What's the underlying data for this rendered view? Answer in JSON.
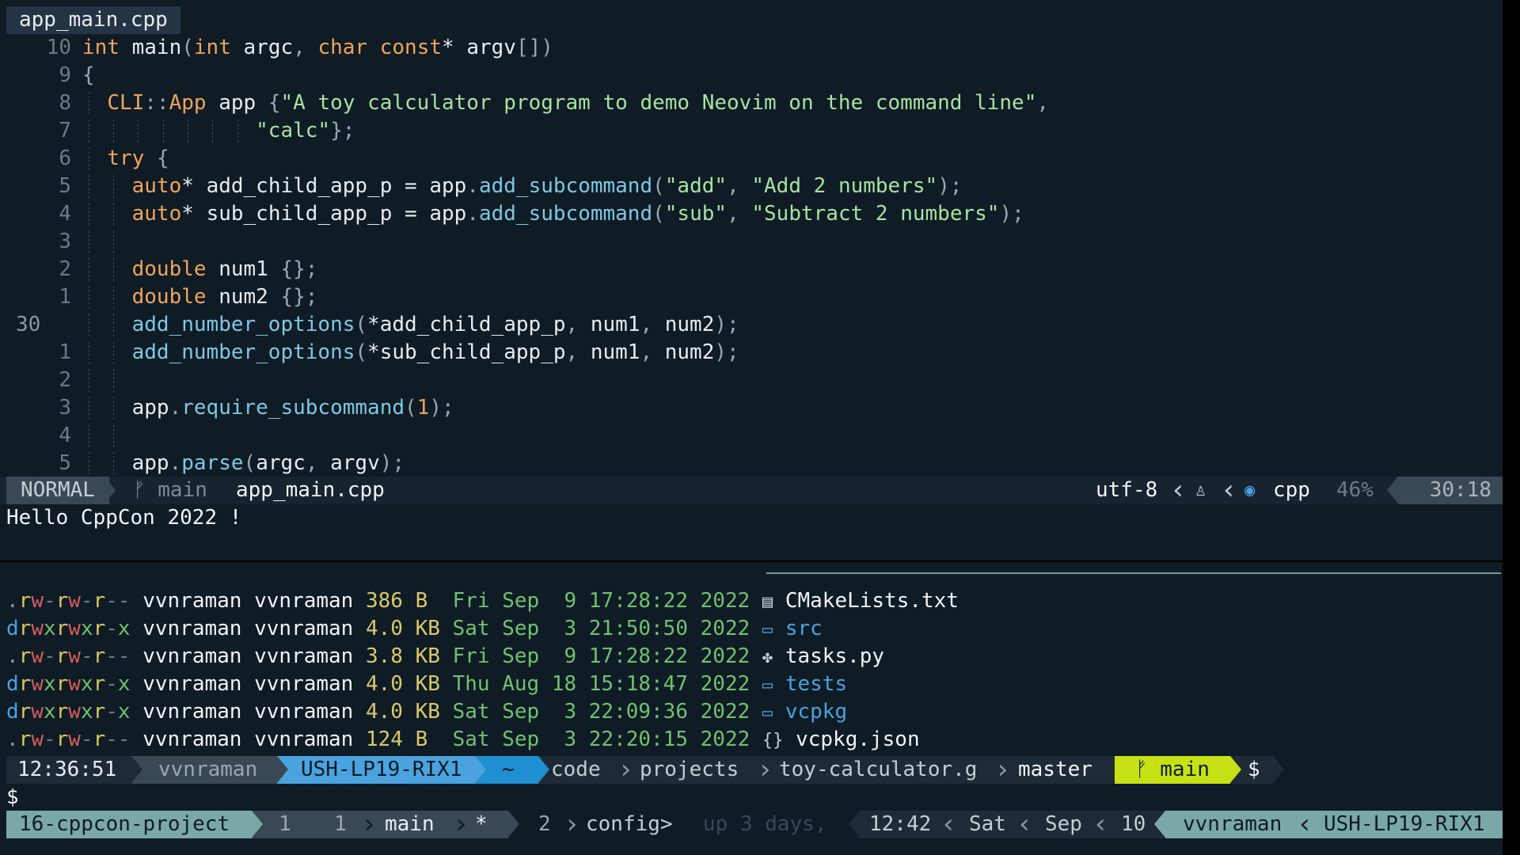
{
  "editor": {
    "tab_label": "app_main.cpp",
    "lines": [
      {
        "n": "10",
        "html": "<span class=\"kw\">int</span> <span class=\"var\">main</span><span class=\"pun\">(</span><span class=\"kw\">int</span> <span class=\"var\">argc</span><span class=\"pun\">,</span> <span class=\"kw\">char const</span><span class=\"var\">*</span> <span class=\"var\">argv</span><span class=\"pun\">[])</span>"
      },
      {
        "n": "9",
        "html": "<span class=\"pun\">{</span>"
      },
      {
        "n": "8",
        "html": "  <span class=\"kw\">CLI</span><span class=\"pun\">::</span><span class=\"kw\">App</span> <span class=\"var\">app</span> <span class=\"pun\">{</span><span class=\"str\">\"A toy calculator program to demo Neovim on the command line\"</span><span class=\"pun\">,</span>"
      },
      {
        "n": "7",
        "html": "              <span class=\"str\">\"calc\"</span><span class=\"pun\">};</span>"
      },
      {
        "n": "6",
        "html": "  <span class=\"kw\">try</span> <span class=\"pun\">{</span>"
      },
      {
        "n": "5",
        "html": "    <span class=\"kw\">auto</span><span class=\"var\">*</span> <span class=\"var\">add_child_app_p</span> <span class=\"var\">=</span> <span class=\"var\">app</span><span class=\"pun\">.</span><span class=\"fn\">add_subcommand</span><span class=\"pun\">(</span><span class=\"str\">\"add\"</span><span class=\"pun\">,</span> <span class=\"str\">\"Add 2 numbers\"</span><span class=\"pun\">);</span>"
      },
      {
        "n": "4",
        "html": "    <span class=\"kw\">auto</span><span class=\"var\">*</span> <span class=\"var\">sub_child_app_p</span> <span class=\"var\">=</span> <span class=\"var\">app</span><span class=\"pun\">.</span><span class=\"fn\">add_subcommand</span><span class=\"pun\">(</span><span class=\"str\">\"sub\"</span><span class=\"pun\">,</span> <span class=\"str\">\"Subtract 2 numbers\"</span><span class=\"pun\">);</span>"
      },
      {
        "n": "3",
        "html": ""
      },
      {
        "n": "2",
        "html": "    <span class=\"kw\">double</span> <span class=\"var\">num1</span> <span class=\"pun\">{};</span>"
      },
      {
        "n": "1",
        "html": "    <span class=\"kw\">double</span> <span class=\"var\">num2</span> <span class=\"pun\">{};</span>"
      },
      {
        "n": "30",
        "current": true,
        "html": "    <span class=\"fn\">add_number_options</span><span class=\"pun\">(</span><span class=\"var\">*add_child_app_p</span><span class=\"pun\">,</span> <span class=\"var\">num1</span><span class=\"pun\">,</span> <span class=\"var\">num2</span><span class=\"pun\">);</span>"
      },
      {
        "n": "1",
        "html": "    <span class=\"fn\">add_number_options</span><span class=\"pun\">(</span><span class=\"var\">*sub_child_app_p</span><span class=\"pun\">,</span> <span class=\"var\">num1</span><span class=\"pun\">,</span> <span class=\"var\">num2</span><span class=\"pun\">);</span>"
      },
      {
        "n": "2",
        "html": ""
      },
      {
        "n": "3",
        "html": "    <span class=\"var\">app</span><span class=\"pun\">.</span><span class=\"fn\">require_subcommand</span><span class=\"pun\">(</span><span class=\"num\">1</span><span class=\"pun\">);</span>"
      },
      {
        "n": "4",
        "html": ""
      },
      {
        "n": "5",
        "html": "    <span class=\"var\">app</span><span class=\"pun\">.</span><span class=\"fn\">parse</span><span class=\"pun\">(</span><span class=\"var\">argc</span><span class=\"pun\">,</span> <span class=\"var\">argv</span><span class=\"pun\">);</span>"
      }
    ]
  },
  "statusline": {
    "mode": "NORMAL",
    "branch_icon": "ᚠ",
    "branch": "main",
    "file": "app_main.cpp",
    "encoding": "utf-8",
    "os_icon": "♙",
    "filetype_icon": "◉",
    "filetype": "cpp",
    "percent": "46%",
    "position": "30:18"
  },
  "command_output": "Hello CppCon 2022 !",
  "listing": [
    {
      "perm": [
        [
          "p-dot",
          "."
        ],
        [
          "p-r",
          "r"
        ],
        [
          "p-w",
          "w"
        ],
        [
          "p-dash",
          "-"
        ],
        [
          "p-r",
          "r"
        ],
        [
          "p-w",
          "w"
        ],
        [
          "p-dash",
          "-"
        ],
        [
          "p-r",
          "r"
        ],
        [
          "p-dash",
          "-"
        ],
        [
          "p-dash",
          "-"
        ]
      ],
      "user": "vvnraman",
      "group": "vvnraman",
      "size": "386 B ",
      "day": "Fri",
      "mon": "Sep",
      "dd": " 9",
      "time": "17:28:22",
      "year": "2022",
      "icon": "▤",
      "name": "CMakeLists.txt",
      "dir": false
    },
    {
      "perm": [
        [
          "p-d",
          "d"
        ],
        [
          "p-r",
          "r"
        ],
        [
          "p-w",
          "w"
        ],
        [
          "p-x",
          "x"
        ],
        [
          "p-r",
          "r"
        ],
        [
          "p-w",
          "w"
        ],
        [
          "p-x",
          "x"
        ],
        [
          "p-r",
          "r"
        ],
        [
          "p-dash",
          "-"
        ],
        [
          "p-x",
          "x"
        ]
      ],
      "user": "vvnraman",
      "group": "vvnraman",
      "size": "4.0 KB",
      "day": "Sat",
      "mon": "Sep",
      "dd": " 3",
      "time": "21:50:50",
      "year": "2022",
      "icon": "▭",
      "name": "src",
      "dir": true
    },
    {
      "perm": [
        [
          "p-dot",
          "."
        ],
        [
          "p-r",
          "r"
        ],
        [
          "p-w",
          "w"
        ],
        [
          "p-dash",
          "-"
        ],
        [
          "p-r",
          "r"
        ],
        [
          "p-w",
          "w"
        ],
        [
          "p-dash",
          "-"
        ],
        [
          "p-r",
          "r"
        ],
        [
          "p-dash",
          "-"
        ],
        [
          "p-dash",
          "-"
        ]
      ],
      "user": "vvnraman",
      "group": "vvnraman",
      "size": "3.8 KB",
      "day": "Fri",
      "mon": "Sep",
      "dd": " 9",
      "time": "17:28:22",
      "year": "2022",
      "icon": "✤",
      "name": "tasks.py",
      "dir": false
    },
    {
      "perm": [
        [
          "p-d",
          "d"
        ],
        [
          "p-r",
          "r"
        ],
        [
          "p-w",
          "w"
        ],
        [
          "p-x",
          "x"
        ],
        [
          "p-r",
          "r"
        ],
        [
          "p-w",
          "w"
        ],
        [
          "p-x",
          "x"
        ],
        [
          "p-r",
          "r"
        ],
        [
          "p-dash",
          "-"
        ],
        [
          "p-x",
          "x"
        ]
      ],
      "user": "vvnraman",
      "group": "vvnraman",
      "size": "4.0 KB",
      "day": "Thu",
      "mon": "Aug",
      "dd": "18",
      "time": "15:18:47",
      "year": "2022",
      "icon": "▭",
      "name": "tests",
      "dir": true
    },
    {
      "perm": [
        [
          "p-d",
          "d"
        ],
        [
          "p-r",
          "r"
        ],
        [
          "p-w",
          "w"
        ],
        [
          "p-x",
          "x"
        ],
        [
          "p-r",
          "r"
        ],
        [
          "p-w",
          "w"
        ],
        [
          "p-x",
          "x"
        ],
        [
          "p-r",
          "r"
        ],
        [
          "p-dash",
          "-"
        ],
        [
          "p-x",
          "x"
        ]
      ],
      "user": "vvnraman",
      "group": "vvnraman",
      "size": "4.0 KB",
      "day": "Sat",
      "mon": "Sep",
      "dd": " 3",
      "time": "22:09:36",
      "year": "2022",
      "icon": "▭",
      "name": "vcpkg",
      "dir": true
    },
    {
      "perm": [
        [
          "p-dot",
          "."
        ],
        [
          "p-r",
          "r"
        ],
        [
          "p-w",
          "w"
        ],
        [
          "p-dash",
          "-"
        ],
        [
          "p-r",
          "r"
        ],
        [
          "p-w",
          "w"
        ],
        [
          "p-dash",
          "-"
        ],
        [
          "p-r",
          "r"
        ],
        [
          "p-dash",
          "-"
        ],
        [
          "p-dash",
          "-"
        ]
      ],
      "user": "vvnraman",
      "group": "vvnraman",
      "size": "124 B ",
      "day": "Sat",
      "mon": "Sep",
      "dd": " 3",
      "time": "22:20:15",
      "year": "2022",
      "icon": "{}",
      "name": "vcpkg.json",
      "dir": false
    }
  ],
  "prompt": {
    "time": "12:36:51",
    "user": "vvnraman",
    "host": "USH-LP19-RIX1",
    "home": "~",
    "path": [
      "code",
      "projects",
      "toy-calculator.g",
      "master"
    ],
    "git_icon": "ᚠ",
    "git_branch": "main",
    "symbol": "$",
    "input_line": "$"
  },
  "tmux": {
    "session": "16-cppcon-project",
    "window_index": "1",
    "pane_index": "1",
    "window_name": "main",
    "window_flag": "*",
    "window2_index": "2",
    "window2_name": "config>",
    "uptime": "up 3 days,",
    "clock": "12:42",
    "day": "Sat",
    "month": "Sep",
    "date": "10",
    "user": "vvnraman",
    "host": "USH-LP19-RIX1"
  },
  "colors": {
    "background": "#0f1b25",
    "prompt_time_bg": "#1e2a35",
    "prompt_user_bg": "#3a4856",
    "prompt_host_bg": "#4aa3df",
    "prompt_home_bg": "#1f8fd1",
    "prompt_git_bg": "#c6e215",
    "tmux_session_bg": "#7aa8a7",
    "tmux_right_bg": "#7aa8a7"
  }
}
